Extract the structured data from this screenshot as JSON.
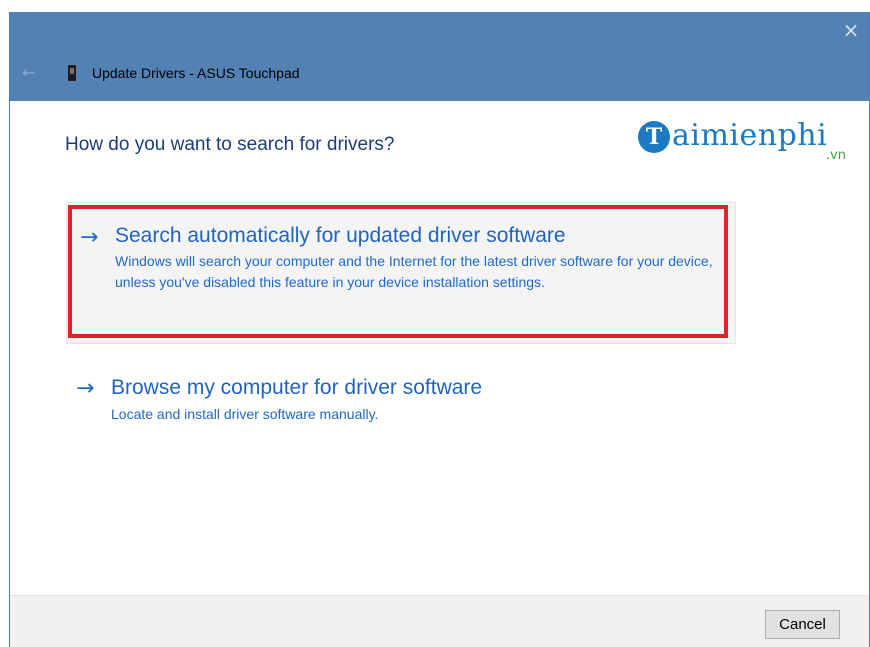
{
  "window": {
    "title": "Update Drivers - ASUS Touchpad",
    "close_glyph": "×",
    "back_glyph": "←"
  },
  "main": {
    "heading": "How do you want to search for drivers?"
  },
  "watermark": {
    "letter": "T",
    "text": "aimienphi",
    "suffix": ".vn",
    "color": "#1c7ac4"
  },
  "options": [
    {
      "arrow": "→",
      "title": "Search automatically for updated driver software",
      "description": "Windows will search your computer and the Internet for the latest driver software for your device, unless you've disabled this feature in your device installation settings.",
      "highlighted": true,
      "highlight_color": "#d8262b"
    },
    {
      "arrow": "→",
      "title": "Browse my computer for driver software",
      "description": "Locate and install driver software manually.",
      "highlighted": false
    }
  ],
  "footer": {
    "cancel_label": "Cancel"
  },
  "colors": {
    "titlebar": "#5381b4",
    "link": "#1f64bf",
    "heading": "#1e3d7a"
  }
}
